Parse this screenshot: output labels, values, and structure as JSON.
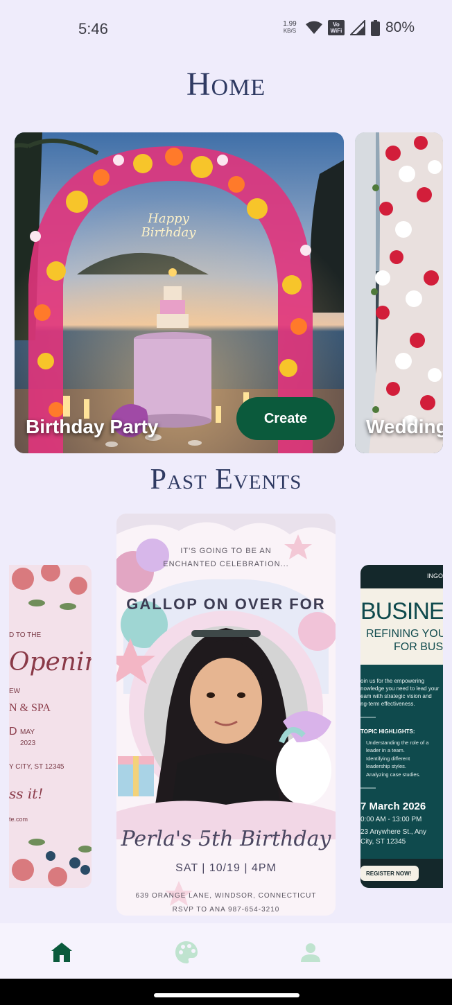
{
  "status": {
    "time": "5:46",
    "speed_value": "1.99",
    "speed_unit": "KB/S",
    "vowifi_top": "Vo",
    "vowifi_bottom": "WiFi",
    "battery": "80%"
  },
  "home": {
    "title": "Home",
    "cards": [
      {
        "label": "Birthday Party",
        "action": "Create"
      },
      {
        "label": "Wedding"
      }
    ]
  },
  "past_events": {
    "title": "Past Events",
    "left_poster": {
      "line1": "D TO THE",
      "script": "Opening",
      "line2": "EW",
      "line3": "N & SPA",
      "line4": "D",
      "month": "MAY",
      "year": "2023",
      "address": "Y CITY, ST 12345",
      "tagline": "ss it!",
      "web": "te.com"
    },
    "center_poster": {
      "intro1": "IT'S GOING TO BE AN",
      "intro2": "ENCHANTED CELEBRATION...",
      "arc": "GALLOP ON OVER FOR",
      "name": "Perla's 5th Birthday",
      "when": "SAT | 10/19 | 4PM",
      "address": "639 ORANGE LANE, WINDSOR, CONNECTICUT",
      "rsvp": "RSVP TO ANA 987-654-3210"
    },
    "right_poster": {
      "brand": "INGO",
      "headline": "BUSINES",
      "sub1": "REFINING YOUR",
      "sub2": "FOR BUSI",
      "body1": "oin us for the empowering",
      "body2": "nowledge you need to lead your",
      "body3": "eam with strategic vision and",
      "body4": "ng-term effectiveness.",
      "topics_title": "TOPIC HIGHLIGHTS:",
      "topic1a": "Understanding the role of a",
      "topic1b": "leader in a team.",
      "topic2a": "Identifying different",
      "topic2b": "leadership styles.",
      "topic3": "Analyzing case studies.",
      "date": "7 March 2026",
      "time": "0:00 AM - 13:00 PM",
      "addr1": "23 Anywhere St., Any",
      "addr2": "City, ST 12345",
      "cta": "REGISTER NOW!"
    }
  },
  "nav": {
    "items": [
      "home-icon",
      "palette-icon",
      "person-icon"
    ],
    "active_color": "#0b5a3c",
    "inactive_color": "#bfe3cf"
  }
}
